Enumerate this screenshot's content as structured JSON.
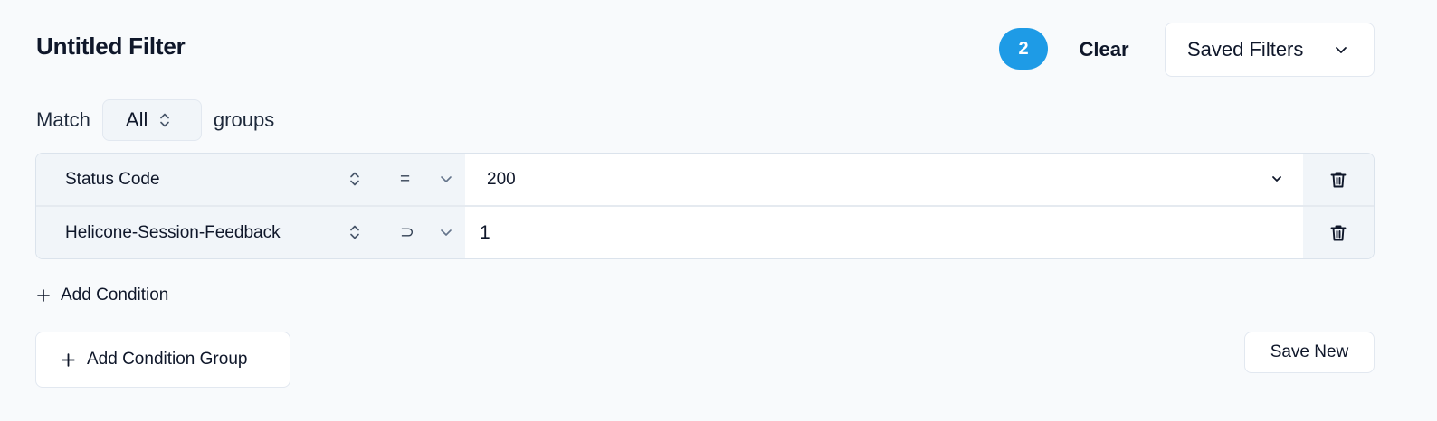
{
  "header": {
    "title": "Untitled Filter",
    "active_count": "2",
    "clear_label": "Clear",
    "saved_filters_label": "Saved Filters"
  },
  "match": {
    "prefix": "Match",
    "selected": "All",
    "suffix": "groups"
  },
  "conditions": [
    {
      "field": "Status Code",
      "operator": "=",
      "value": "200"
    },
    {
      "field": "Helicone-Session-Feedback",
      "operator": "⊃",
      "value": "1"
    }
  ],
  "actions": {
    "add_condition_label": "Add Condition",
    "add_group_label": "Add Condition Group",
    "save_new_label": "Save New"
  },
  "icons": {
    "dropdown": "chevron-down-icon",
    "sort": "chevron-up-down-icon",
    "delete": "trash-icon",
    "add": "plus-icon"
  },
  "colors": {
    "badge": "#1e9be6",
    "background": "#f8fafc",
    "select_background": "#f1f5f9"
  }
}
